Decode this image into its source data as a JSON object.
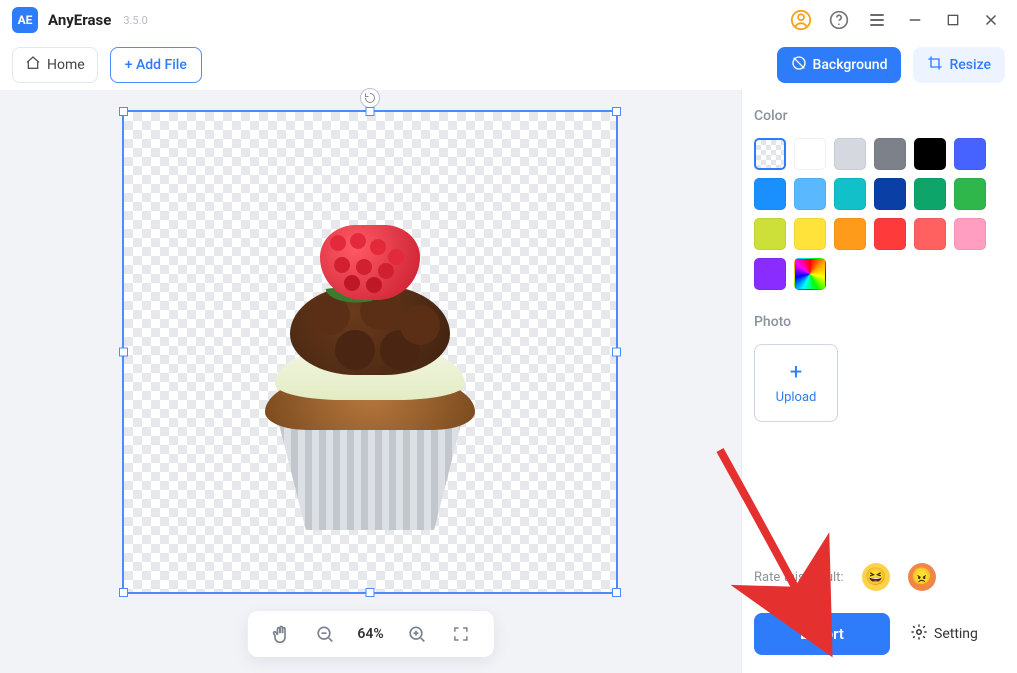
{
  "app": {
    "name": "AnyErase",
    "version": "3.5.0"
  },
  "titlebar_icons": {
    "user": "user-icon",
    "help": "help-icon",
    "menu": "menu-icon",
    "minimize": "minimize-icon",
    "maximize": "maximize-icon",
    "close": "close-icon"
  },
  "toolbar": {
    "home_label": "Home",
    "add_file_label": "+ Add File",
    "background_label": "Background",
    "resize_label": "Resize"
  },
  "canvas": {
    "zoom_text": "64%"
  },
  "panel": {
    "color_label": "Color",
    "photo_label": "Photo",
    "upload_label": "Upload",
    "colors": [
      {
        "id": "transparent",
        "value": "transparent",
        "selected": true
      },
      {
        "id": "white",
        "value": "#ffffff"
      },
      {
        "id": "lightgray",
        "value": "#d5d9df"
      },
      {
        "id": "gray",
        "value": "#7d818a"
      },
      {
        "id": "black",
        "value": "#000000"
      },
      {
        "id": "blue",
        "value": "#4763ff"
      },
      {
        "id": "skyblue",
        "value": "#1a90ff"
      },
      {
        "id": "lightblue",
        "value": "#5ab8ff"
      },
      {
        "id": "teal",
        "value": "#11c0c9"
      },
      {
        "id": "navy",
        "value": "#0a3fa6"
      },
      {
        "id": "green",
        "value": "#0ea56a"
      },
      {
        "id": "green2",
        "value": "#2fb74b"
      },
      {
        "id": "lime",
        "value": "#cde03a"
      },
      {
        "id": "yellow",
        "value": "#ffe23a"
      },
      {
        "id": "orange",
        "value": "#ff9b1a"
      },
      {
        "id": "red",
        "value": "#ff3a3a"
      },
      {
        "id": "coral",
        "value": "#ff6161"
      },
      {
        "id": "pink",
        "value": "#ff9ec0"
      },
      {
        "id": "purple",
        "value": "#8a2bff"
      },
      {
        "id": "rainbow",
        "value": "rainbow"
      }
    ]
  },
  "footer": {
    "rate_label": "Rate this result:",
    "export_label": "Export",
    "setting_label": "Setting"
  }
}
